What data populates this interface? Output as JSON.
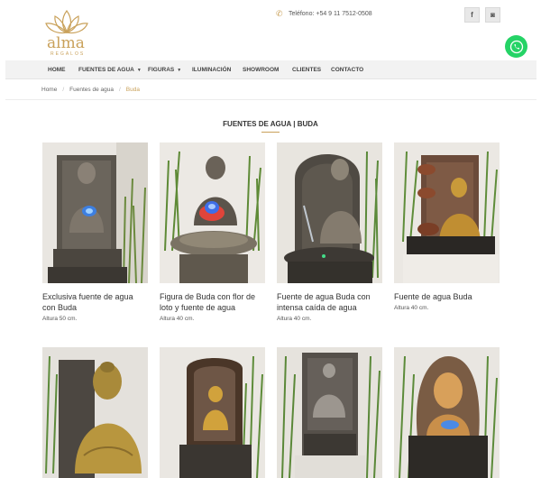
{
  "brand": {
    "name": "alma",
    "tagline": "REGALOS"
  },
  "contact": {
    "phone": "Teléfono: +54 9 11 7512-0508"
  },
  "social": {
    "facebook": "f",
    "instagram": "◙"
  },
  "nav": [
    {
      "label": "HOME"
    },
    {
      "label": "FUENTES DE AGUA",
      "caret": "▼"
    },
    {
      "label": "FIGURAS",
      "caret": "▼"
    },
    {
      "label": "ILUMINACIÓN"
    },
    {
      "label": "SHOWROOM"
    },
    {
      "label": "CLIENTES"
    },
    {
      "label": "CONTACTO"
    }
  ],
  "breadcrumb": {
    "home": "Home",
    "section": "Fuentes de agua",
    "current": "Buda",
    "separator": "/"
  },
  "page_title": "FUENTES DE AGUA | BUDA",
  "products": [
    {
      "name": "Exclusiva fuente de agua con Buda",
      "spec": "Altura 50 cm."
    },
    {
      "name": "Figura de Buda con flor de loto y fuente de agua",
      "spec": "Altura 40 cm."
    },
    {
      "name": "Fuente de agua Buda con intensa caída de agua",
      "spec": "Altura 40 cm."
    },
    {
      "name": "Fuente de agua Buda",
      "spec": "Altura 40 cm."
    },
    {
      "name": "",
      "spec": ""
    },
    {
      "name": "",
      "spec": ""
    },
    {
      "name": "",
      "spec": ""
    },
    {
      "name": "",
      "spec": ""
    }
  ],
  "colors": {
    "accent": "#c9a15a",
    "whatsapp": "#25d366",
    "nav_bg": "#f2f2f2"
  }
}
